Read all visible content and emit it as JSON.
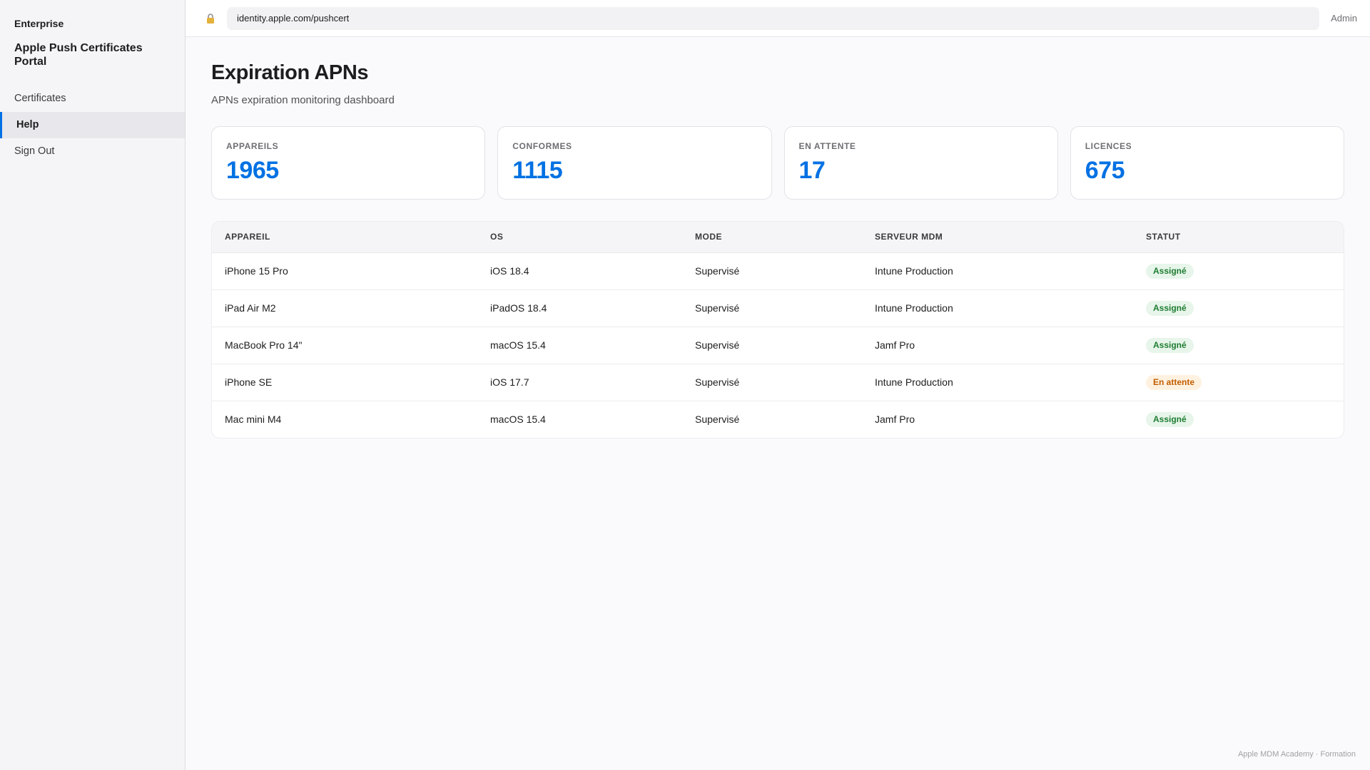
{
  "sidebar": {
    "brand_small": "Enterprise",
    "brand_title": "Apple Push Certificates Portal",
    "items": [
      {
        "label": "Certificates",
        "active": false
      },
      {
        "label": "Help",
        "active": true
      },
      {
        "label": "Sign Out",
        "active": false
      }
    ]
  },
  "topbar": {
    "lock_icon": "lock-icon",
    "url": "identity.apple.com/pushcert",
    "user": "Admin"
  },
  "page": {
    "title": "Expiration APNs",
    "subtitle": "APNs expiration monitoring dashboard"
  },
  "stats": [
    {
      "label": "APPAREILS",
      "value": "1965"
    },
    {
      "label": "CONFORMES",
      "value": "1115"
    },
    {
      "label": "EN ATTENTE",
      "value": "17"
    },
    {
      "label": "LICENCES",
      "value": "675"
    }
  ],
  "table": {
    "headers": [
      "APPAREIL",
      "OS",
      "MODE",
      "SERVEUR MDM",
      "STATUT"
    ],
    "rows": [
      {
        "device": "iPhone 15 Pro",
        "os": "iOS 18.4",
        "mode": "Supervisé",
        "server": "Intune Production",
        "status": "Assigné"
      },
      {
        "device": "iPad Air M2",
        "os": "iPadOS 18.4",
        "mode": "Supervisé",
        "server": "Intune Production",
        "status": "Assigné"
      },
      {
        "device": "MacBook Pro 14\"",
        "os": "macOS 15.4",
        "mode": "Supervisé",
        "server": "Jamf Pro",
        "status": "Assigné"
      },
      {
        "device": "iPhone SE",
        "os": "iOS 17.7",
        "mode": "Supervisé",
        "server": "Intune Production",
        "status": "En attente"
      },
      {
        "device": "Mac mini M4",
        "os": "macOS 15.4",
        "mode": "Supervisé",
        "server": "Jamf Pro",
        "status": "Assigné"
      }
    ]
  },
  "colors": {
    "accent": "#0071e3",
    "status_ok_bg": "#e7f5ea",
    "status_ok_text": "#1e7d32",
    "status_wait_bg": "#fff1e0",
    "status_wait_text": "#c25e00"
  },
  "footer": "Apple MDM Academy · Formation"
}
